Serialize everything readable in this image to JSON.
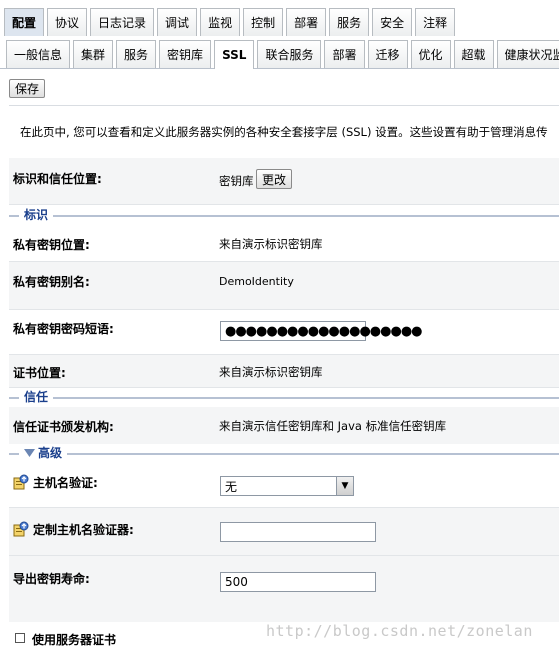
{
  "tabs_primary": [
    {
      "label": "配置",
      "active": true
    },
    {
      "label": "协议"
    },
    {
      "label": "日志记录"
    },
    {
      "label": "调试"
    },
    {
      "label": "监视"
    },
    {
      "label": "控制"
    },
    {
      "label": "部署"
    },
    {
      "label": "服务"
    },
    {
      "label": "安全"
    },
    {
      "label": "注释"
    }
  ],
  "tabs_secondary": [
    {
      "label": "一般信息"
    },
    {
      "label": "集群"
    },
    {
      "label": "服务"
    },
    {
      "label": "密钥库"
    },
    {
      "label": "SSL",
      "active": true
    },
    {
      "label": "联合服务"
    },
    {
      "label": "部署"
    },
    {
      "label": "迁移"
    },
    {
      "label": "优化"
    },
    {
      "label": "超载"
    },
    {
      "label": "健康状况监控"
    }
  ],
  "toolbar": {
    "save_label": "保存"
  },
  "intro_text": "在此页中, 您可以查看和定义此服务器实例的各种安全套接字层 (SSL) 设置。这些设置有助于管理消息传",
  "identity_trust": {
    "label": "标识和信任位置:",
    "value": "密钥库",
    "change_label": "更改"
  },
  "section_identity": {
    "title": "标识"
  },
  "private_key_location": {
    "label": "私有密钥位置:",
    "value": "来自演示标识密钥库"
  },
  "private_key_alias": {
    "label": "私有密钥别名:",
    "value": "DemoIdentity"
  },
  "private_key_passphrase": {
    "label": "私有密钥密码短语:",
    "value": "●●●●●●●●●●●●●●●●●●●"
  },
  "certificate_location": {
    "label": "证书位置:",
    "value": "来自演示标识密钥库"
  },
  "section_trust": {
    "title": "信任"
  },
  "trusted_ca": {
    "label": "信任证书颁发机构:",
    "value": "来自演示信任密钥库和 Java 标准信任密钥库"
  },
  "section_advanced": {
    "title": "高级"
  },
  "hostname_verification": {
    "label": "主机名验证:",
    "value": "无"
  },
  "custom_hostname_verifier": {
    "label": "定制主机名验证器:",
    "value": ""
  },
  "export_key_lifespan": {
    "label": "导出密钥寿命:",
    "value": "500"
  },
  "use_server_certs": {
    "label": "使用服务器证书",
    "checked": false
  },
  "watermark": "http://blog.csdn.net/zonelan"
}
